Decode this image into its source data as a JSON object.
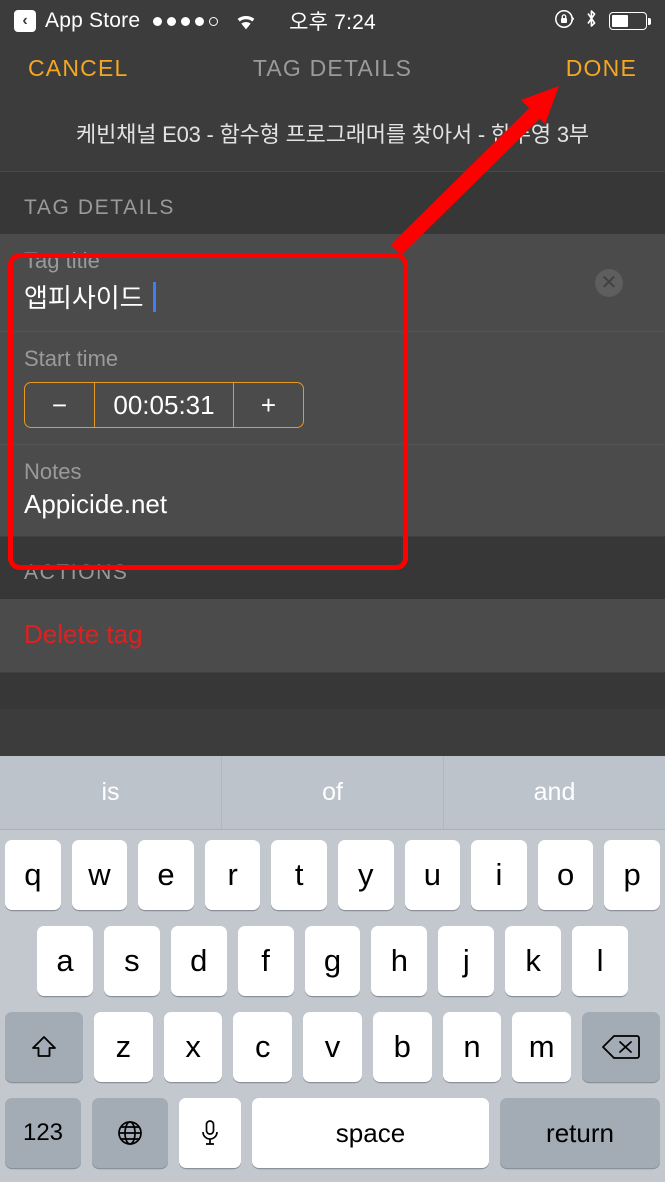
{
  "status_bar": {
    "back_app": "App Store",
    "back_icon": "chevron-left-icon",
    "signal_dots_filled": 4,
    "signal_dots_total": 5,
    "wifi_icon": "wifi-icon",
    "time": "오후 7:24",
    "rotation_lock_icon": "rotation-lock-icon",
    "bluetooth_icon": "bluetooth-icon",
    "battery_icon": "battery-icon",
    "battery_level_percent": 50
  },
  "nav_bar": {
    "cancel_label": "CANCEL",
    "title": "TAG DETAILS",
    "done_label": "DONE",
    "accent_color": "#f5a623"
  },
  "episode": {
    "title": "케빈채널 E03 - 함수형 프로그래머를 찾아서 - 한주영 3부"
  },
  "sections": [
    {
      "header": "TAG DETAILS",
      "rows": [
        {
          "label": "Tag title",
          "value": "앱피사이드",
          "has_caret": true,
          "clear_icon": "clear-circle-icon"
        },
        {
          "label": "Start time",
          "value": "00:05:31",
          "minus_label": "−",
          "plus_label": "+"
        },
        {
          "label": "Notes",
          "value": "Appicide.net"
        }
      ]
    },
    {
      "header": "ACTIONS",
      "rows": [
        {
          "label": "Delete tag",
          "color": "#e02020"
        }
      ]
    }
  ],
  "keyboard": {
    "predictive": [
      "is",
      "of",
      "and"
    ],
    "row1": [
      "q",
      "w",
      "e",
      "r",
      "t",
      "y",
      "u",
      "i",
      "o",
      "p"
    ],
    "row2": [
      "a",
      "s",
      "d",
      "f",
      "g",
      "h",
      "j",
      "k",
      "l"
    ],
    "row3": [
      "z",
      "x",
      "c",
      "v",
      "b",
      "n",
      "m"
    ],
    "shift_icon": "shift-up-arrow-icon",
    "backspace_icon": "backspace-icon",
    "numbers_label": "123",
    "globe_icon": "globe-icon",
    "mic_icon": "microphone-icon",
    "space_label": "space",
    "return_label": "return"
  },
  "annotations": {
    "highlight_color": "#fe0000",
    "rectangle_target": "tag-details-fields",
    "arrow_target": "done-button"
  }
}
